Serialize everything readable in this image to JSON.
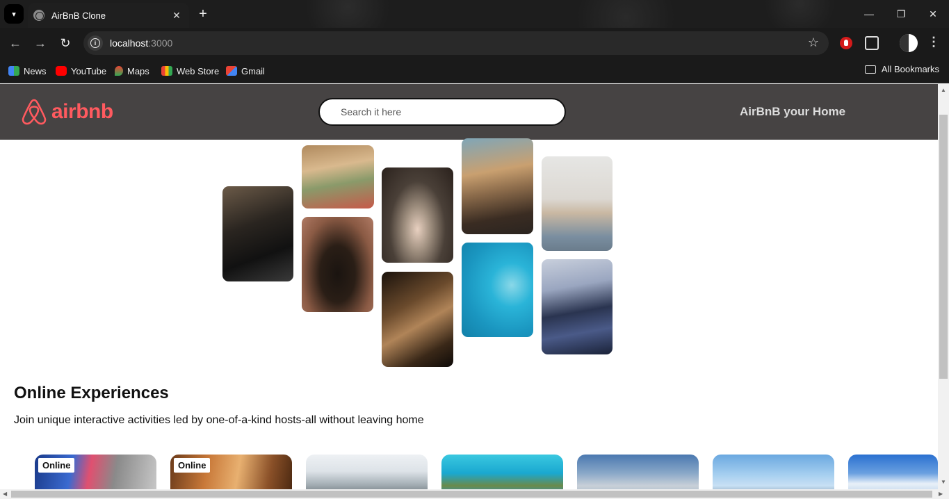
{
  "browser": {
    "tab_title": "AirBnB Clone",
    "url_host": "localhost",
    "url_port": ":3000",
    "bookmarks": [
      "News",
      "YouTube",
      "Maps",
      "Web Store",
      "Gmail"
    ],
    "all_bookmarks": "All Bookmarks"
  },
  "header": {
    "logo_text": "airbnb",
    "search_placeholder": "Search it here",
    "tagline": "AirBnB your Home"
  },
  "section": {
    "title": "Online Experiences",
    "subtitle": "Join unique interactive activities led by one-of-a-kind hosts-all without leaving home"
  },
  "cards": [
    {
      "badge": "Online"
    },
    {
      "badge": "Online"
    },
    {
      "badge": ""
    },
    {
      "badge": ""
    },
    {
      "badge": ""
    },
    {
      "badge": ""
    },
    {
      "badge": ""
    }
  ],
  "colors": {
    "brand": "#ff5a5f",
    "header_bg": "#464343"
  }
}
